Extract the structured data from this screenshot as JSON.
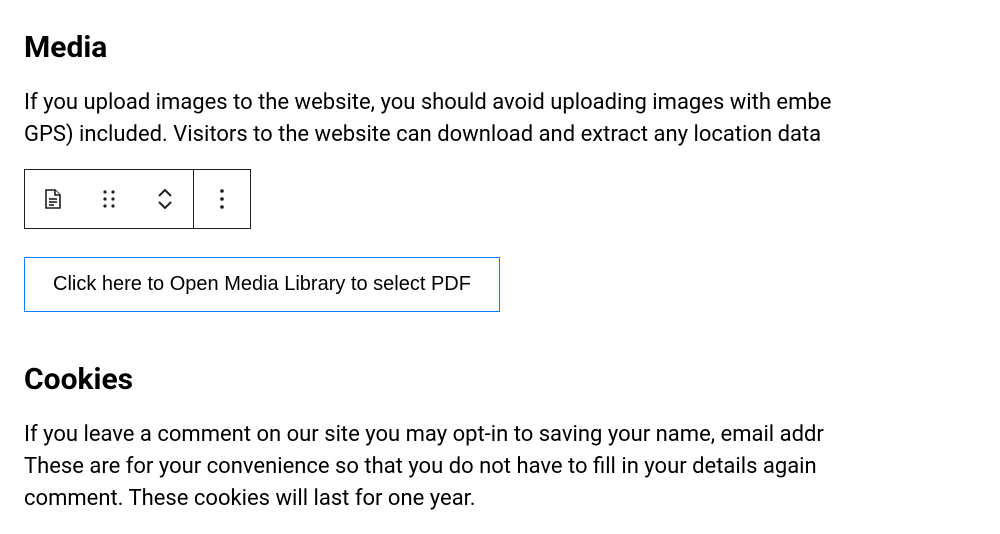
{
  "sections": {
    "media": {
      "heading": "Media",
      "paragraph_line1": "If you upload images to the website, you should avoid uploading images with embe",
      "paragraph_line2": "GPS) included. Visitors to the website can download and extract any location data "
    },
    "cookies": {
      "heading": "Cookies",
      "paragraph_line1": "If you leave a comment on our site you may opt-in to saving your name, email addr",
      "paragraph_line2": "These are for your convenience so that you do not have to fill in your details again ",
      "paragraph_line3": "comment. These cookies will last for one year."
    }
  },
  "block": {
    "media_library_button": "Click here to Open Media Library to select PDF"
  }
}
